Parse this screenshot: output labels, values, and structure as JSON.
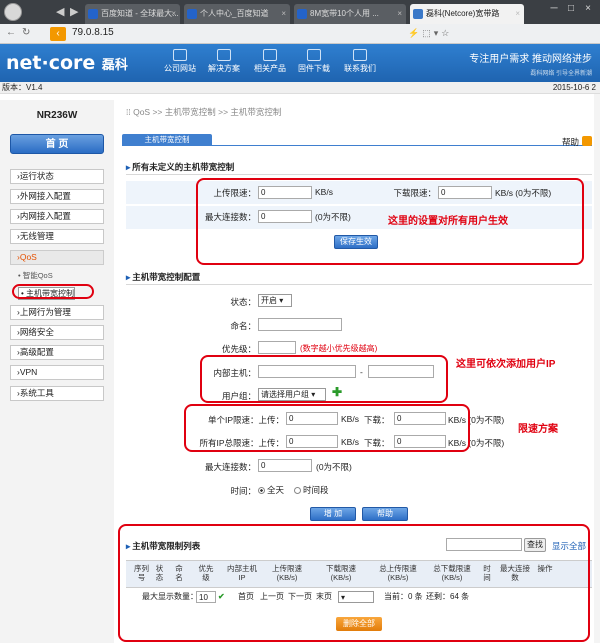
{
  "browser": {
    "tabs": [
      {
        "title": "百度知道 - 全球最大...",
        "color": "#2463c9"
      },
      {
        "title": "个人中心_百度知道",
        "color": "#2463c9"
      },
      {
        "title": "8M宽带10个人用 ...",
        "color": "#2463c9"
      },
      {
        "title": "磊科(Netcore)宽带路",
        "color": "#3a78c8"
      }
    ],
    "address": "79.0.8.15"
  },
  "router": {
    "brand": "net·core",
    "brand_cn": "磊科",
    "nav": [
      "公司网站",
      "解决方案",
      "相关产品",
      "固件下载",
      "联系我们"
    ],
    "slogan": "专注用户需求  推动网络进步",
    "slogan_small": "磊科网络  引导全界新潮",
    "version": "版本：V1.4",
    "date": "2015-10-6 2"
  },
  "sidebar": {
    "model": "NR236W",
    "home": "首  页",
    "items": [
      "运行状态",
      "外网接入配置",
      "内网接入配置",
      "无线管理",
      "QoS"
    ],
    "qos_subs": [
      "智能QoS",
      "主机带宽控制"
    ],
    "items2": [
      "上网行为管理",
      "网络安全",
      "高级配置",
      "VPN",
      "系统工具"
    ]
  },
  "main": {
    "breadcrumb": "QoS  >>  主机带宽控制  >>  主机带宽控制",
    "tab": "主机带宽控制",
    "help": "帮助",
    "section1": {
      "title": "所有未定义的主机带宽控制",
      "upload_label": "上传限速：",
      "upload_value": "0",
      "upload_unit": "KB/s",
      "download_label": "下载限速：",
      "download_value": "0",
      "download_unit": "KB/s (0为不限)",
      "maxconn_label": "最大连接数：",
      "maxconn_value": "0",
      "maxconn_note": "(0为不限)",
      "save": "保存生效"
    },
    "section2": {
      "title": "主机带宽控制配置",
      "state_label": "状态：",
      "state_value": "开启",
      "name_label": "命名：",
      "name_value": "",
      "priority_label": "优先级：",
      "priority_value": "",
      "priority_note": "(数字越小优先级越高)",
      "host_label": "内部主机：",
      "host_start": "",
      "host_end": "",
      "group_label": "用户组：",
      "group_value": "请选择用户组",
      "single_label": "单个IP限速：上传：",
      "single_up": "0",
      "single_unit": "KB/s",
      "single_down_label": "下载：",
      "single_down": "0",
      "single_down_unit": "KB/s (0为不限)",
      "total_label": "所有IP总限速：上传：",
      "total_up": "0",
      "total_unit": "KB/s",
      "total_down_label": "下载：",
      "total_down": "0",
      "total_down_unit": "KB/s (0为不限)",
      "maxconn_label": "最大连接数：",
      "maxconn_value": "0",
      "maxconn_note": "(0为不限)",
      "time_label": "时间：",
      "time_all": "全天",
      "time_period": "时间段",
      "add": "增 加",
      "help": "帮助"
    },
    "section3": {
      "title": "主机带宽限制列表",
      "search": "查找",
      "show_all": "显示全部",
      "columns": [
        "序列\n号",
        "状\n态",
        "命\n名",
        "优先\n级",
        "内部主机\nIP",
        "上传限速\n(KB/s)",
        "下载限速\n(KB/s)",
        "总上传限速\n(KB/s)",
        "总下载限速\n(KB/s)",
        "时\n间",
        "最大连接\n数",
        "操作"
      ],
      "max_show_label": "最大显示数量：",
      "max_show_value": "10",
      "first": "首页",
      "prev": "上一页",
      "next": "下一页",
      "last": "末页",
      "current": "当前：0 条",
      "total": "还剩：64 条",
      "delete_all": "删除全部"
    },
    "annotations": {
      "a1": "这里的设置对所有用户生效",
      "a2": "这里可依次添加用户IP",
      "a3": "限速方案"
    }
  }
}
